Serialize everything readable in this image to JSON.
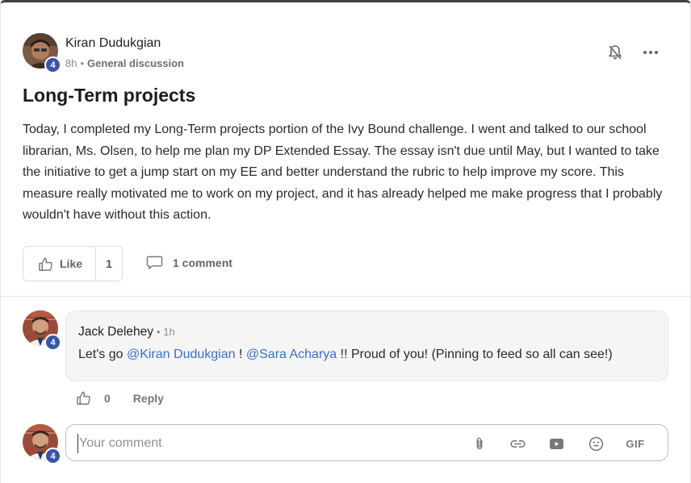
{
  "post": {
    "author": "Kiran Dudukgian",
    "level": "4",
    "time": "8h",
    "separator": "•",
    "category": "General discussion",
    "title": "Long-Term projects",
    "body": "Today, I completed my Long-Term projects portion of the Ivy Bound challenge. I went and talked to our school librarian, Ms. Olsen, to help me plan my DP Extended Essay. The essay isn't due until May, but I wanted to take the initiative to get a jump start on my EE and better understand the rubric to help improve my score. This measure really motivated me to work on my project, and it has already helped me make progress that I probably wouldn't have without this action.",
    "like_label": "Like",
    "like_count": "1",
    "comment_label": "1 comment"
  },
  "comment": {
    "author": "Jack Delehey",
    "time": "• 1h",
    "level": "4",
    "text_prefix": "Let's go ",
    "mention_1": "@Kiran Dudukgian",
    "text_mid": " ! ",
    "mention_2": "@Sara Acharya",
    "text_suffix": " !! Proud of you! (Pinning to feed so all can see!)",
    "like_count": "0",
    "reply_label": "Reply"
  },
  "composer": {
    "level": "4",
    "placeholder": "Your comment",
    "gif_label": "GIF",
    "tools": [
      "paperclip-icon",
      "link-icon",
      "video-icon",
      "emoji-icon",
      "gif-button"
    ]
  },
  "colors": {
    "mention": "#3b6fc7",
    "level_badge": "#3a55a5"
  }
}
